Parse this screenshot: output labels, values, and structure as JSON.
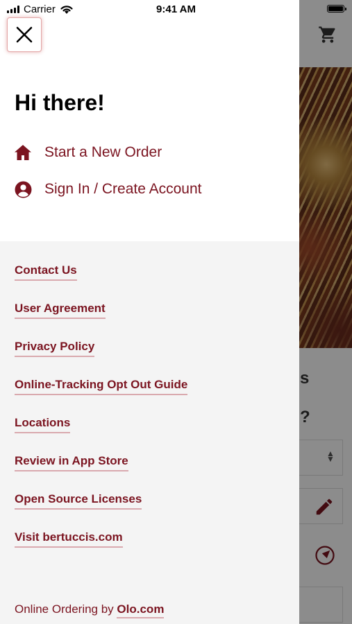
{
  "status_bar": {
    "carrier": "Carrier",
    "time": "9:41 AM"
  },
  "background_app": {
    "heading_fragment": "s",
    "question_fragment": "?"
  },
  "drawer": {
    "greeting": "Hi there!",
    "actions": [
      {
        "label": "Start a New Order",
        "icon": "home-icon"
      },
      {
        "label": "Sign In / Create Account",
        "icon": "account-icon"
      }
    ],
    "links": [
      "Contact Us",
      "User Agreement",
      "Privacy Policy",
      "Online-Tracking Opt Out Guide",
      "Locations",
      "Review in App Store",
      "Open Source Licenses",
      "Visit bertuccis.com"
    ],
    "footer": {
      "prefix": "Online Ordering by",
      "link": "Olo.com"
    }
  },
  "colors": {
    "brand": "#7b1420",
    "underline": "#d9a9ae",
    "drawer_bg": "#f4f4f4"
  }
}
